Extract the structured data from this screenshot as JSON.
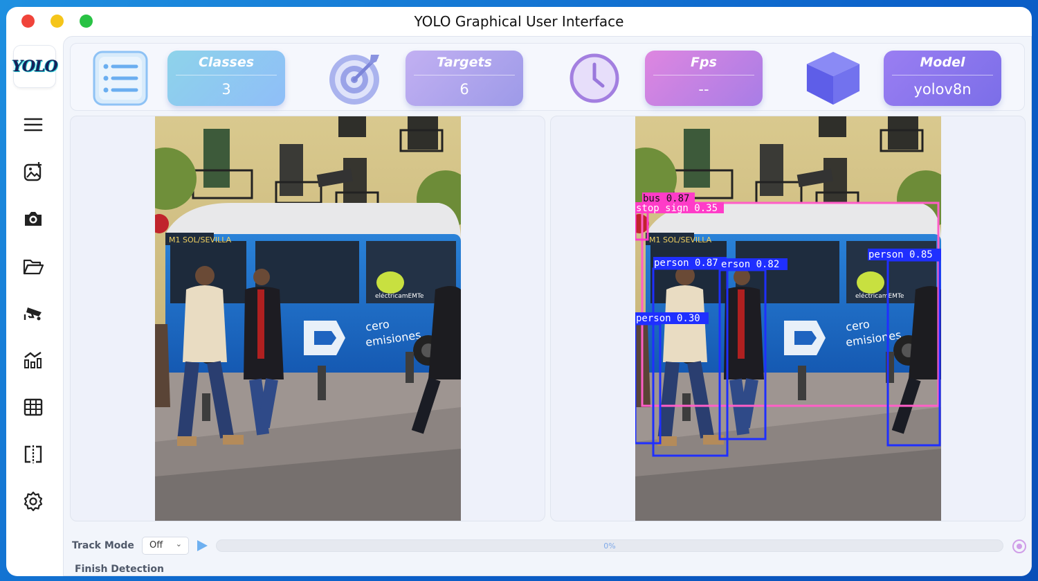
{
  "window": {
    "title": "YOLO Graphical User Interface"
  },
  "sidebar": {
    "logo": "YOLO",
    "items": [
      {
        "name": "menu",
        "icon": "menu-icon"
      },
      {
        "name": "image",
        "icon": "image-add-icon"
      },
      {
        "name": "camera",
        "icon": "camera-icon"
      },
      {
        "name": "folder",
        "icon": "folder-open-icon"
      },
      {
        "name": "cctv",
        "icon": "cctv-camera-icon"
      },
      {
        "name": "chart",
        "icon": "bar-chart-icon"
      },
      {
        "name": "table",
        "icon": "table-icon"
      },
      {
        "name": "split",
        "icon": "split-view-icon"
      },
      {
        "name": "settings",
        "icon": "gear-icon"
      }
    ]
  },
  "stats": {
    "classes": {
      "label": "Classes",
      "value": "3"
    },
    "targets": {
      "label": "Targets",
      "value": "6"
    },
    "fps": {
      "label": "Fps",
      "value": "--"
    },
    "model": {
      "label": "Model",
      "value": "yolov8n"
    }
  },
  "detections": [
    {
      "label": "bus 0.87",
      "color": "#ff3cc8"
    },
    {
      "label": "stop sign 0.35",
      "color": "#ff3cc8"
    },
    {
      "label": "person 0.87",
      "color": "#1f2fff"
    },
    {
      "label": "erson 0.82",
      "color": "#1f2fff"
    },
    {
      "label": "person 0.85",
      "color": "#1f2fff"
    },
    {
      "label": "person 0.30",
      "color": "#1f2fff"
    }
  ],
  "bottom": {
    "track_mode_label": "Track Mode",
    "track_mode_value": "Off",
    "progress": "0%",
    "status": "Finish Detection"
  }
}
